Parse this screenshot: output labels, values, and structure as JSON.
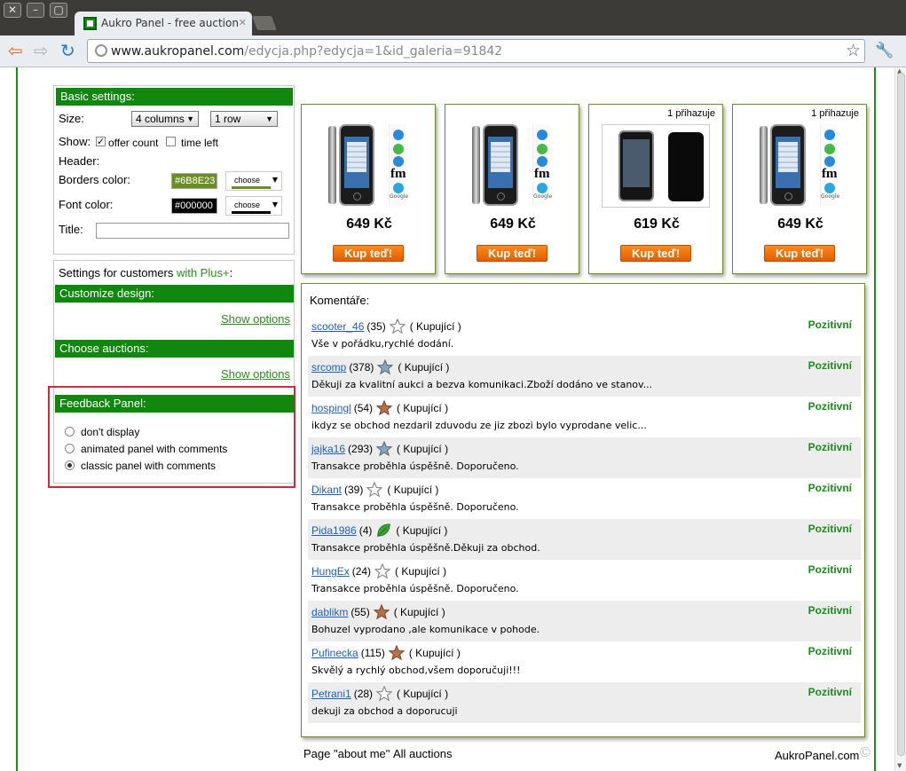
{
  "window": {
    "close_glyph": "✕",
    "minimize_glyph": "–",
    "maximize_glyph": "▢"
  },
  "tab": {
    "title": "Aukro Panel - free auction",
    "close_glyph": "✕"
  },
  "toolbar": {
    "back_glyph": "⇦",
    "forward_glyph": "⇨",
    "reload_glyph": "↻",
    "url_host": "www.aukropanel.com",
    "url_path": "/edycja.php?edycja=1&id_galeria=91842",
    "star_glyph": "☆",
    "wrench_glyph": "🔧"
  },
  "basic_settings": {
    "header": "Basic settings:",
    "size_label": "Size:",
    "columns_value": "4 columns",
    "rows_value": "1 row",
    "show_label": "Show:",
    "offer_count_label": "offer count",
    "offer_count_checked": true,
    "time_left_label": "time left",
    "time_left_checked": false,
    "header_label": "Header:",
    "borders_color_label": "Borders color:",
    "borders_color_value": "#6B8E23",
    "font_color_label": "Font color:",
    "font_color_value": "#000000",
    "choose_label": "choose",
    "title_label": "Title:",
    "title_value": ""
  },
  "plus_settings": {
    "intro": "Settings for customers",
    "plus_link": "with Plus+",
    "colon": ":",
    "customize_header": "Customize design:",
    "choose_auctions_header": "Choose auctions:",
    "show_options": "Show options"
  },
  "feedback_panel": {
    "header": "Feedback Panel:",
    "options": [
      "don't display",
      "animated panel with comments",
      "classic panel with comments"
    ],
    "selected_index": 2
  },
  "products": [
    {
      "bids": "",
      "price": "649 Kč",
      "buy": "Kup teď!",
      "image": "iphone-black"
    },
    {
      "bids": "",
      "price": "649 Kč",
      "buy": "Kup teď!",
      "image": "iphone-black"
    },
    {
      "bids": "1 přihazuje",
      "price": "619 Kč",
      "buy": "Kup teď!",
      "image": "iphone-photo"
    },
    {
      "bids": "1 přihazuje",
      "price": "649 Kč",
      "buy": "Kup teď!",
      "image": "iphone-black"
    }
  ],
  "comments": {
    "title": "Komentáře:",
    "items": [
      {
        "user": "scooter_46",
        "score": "(35)",
        "icon": "star-outline-icon",
        "role": "( Kupující )",
        "rating": "Pozitivní",
        "text": "Vše v pořádku,rychlé dodání."
      },
      {
        "user": "srcomp",
        "score": "(378)",
        "icon": "star-blue-icon",
        "role": "( Kupující )",
        "rating": "Pozitivní",
        "text": "Děkuji za kvalitní aukci a bezva komunikaci.Zboží dodáno ve stanov..."
      },
      {
        "user": "hospingl",
        "score": "(54)",
        "icon": "star-brown-icon",
        "role": "( Kupující )",
        "rating": "Pozitivní",
        "text": "ikdyz se obchod nezdaril zduvodu ze jiz zbozi bylo vyprodane velic..."
      },
      {
        "user": "jajka16",
        "score": "(293)",
        "icon": "star-blue-icon",
        "role": "( Kupující )",
        "rating": "Pozitivní",
        "text": "Transakce proběhla úspěšně. Doporučeno."
      },
      {
        "user": "Dikant",
        "score": "(39)",
        "icon": "star-outline-icon",
        "role": "( Kupující )",
        "rating": "Pozitivní",
        "text": "Transakce proběhla úspěšně. Doporučeno."
      },
      {
        "user": "Pida1986",
        "score": "(4)",
        "icon": "leaf-icon",
        "role": "( Kupující )",
        "rating": "Pozitivní",
        "text": "Transakce proběhla úspěšně.Děkuji za obchod."
      },
      {
        "user": "HungEx",
        "score": "(24)",
        "icon": "star-outline-icon",
        "role": "( Kupující )",
        "rating": "Pozitivní",
        "text": "Transakce proběhla úspěšně. Doporučeno."
      },
      {
        "user": "dablikm",
        "score": "(55)",
        "icon": "star-brown-icon",
        "role": "( Kupující )",
        "rating": "Pozitivní",
        "text": "Bohuzel vyprodano ,ale komunikace v pohode."
      },
      {
        "user": "Pufinecka",
        "score": "(115)",
        "icon": "star-brown-icon",
        "role": "( Kupující )",
        "rating": "Pozitivní",
        "text": "Skvělý a rychlý obchod,všem doporučuji!!!"
      },
      {
        "user": "Petrani1",
        "score": "(28)",
        "icon": "star-outline-icon",
        "role": "( Kupující )",
        "rating": "Pozitivní",
        "text": "dekuji za obchod a doporucuji"
      }
    ]
  },
  "footer": {
    "about_me": "Page \"about me\"",
    "all_auctions": "All auctions",
    "brand": "AukroPanel.com",
    "copyright_glyph": "©"
  },
  "colors": {
    "accent_green": "#128710",
    "positive_green": "#1B8C1B",
    "link_blue": "#1F5FBF",
    "buy_orange": "#F07000",
    "highlight_red": "#D2283A",
    "panel_border": "#6B8E23"
  }
}
